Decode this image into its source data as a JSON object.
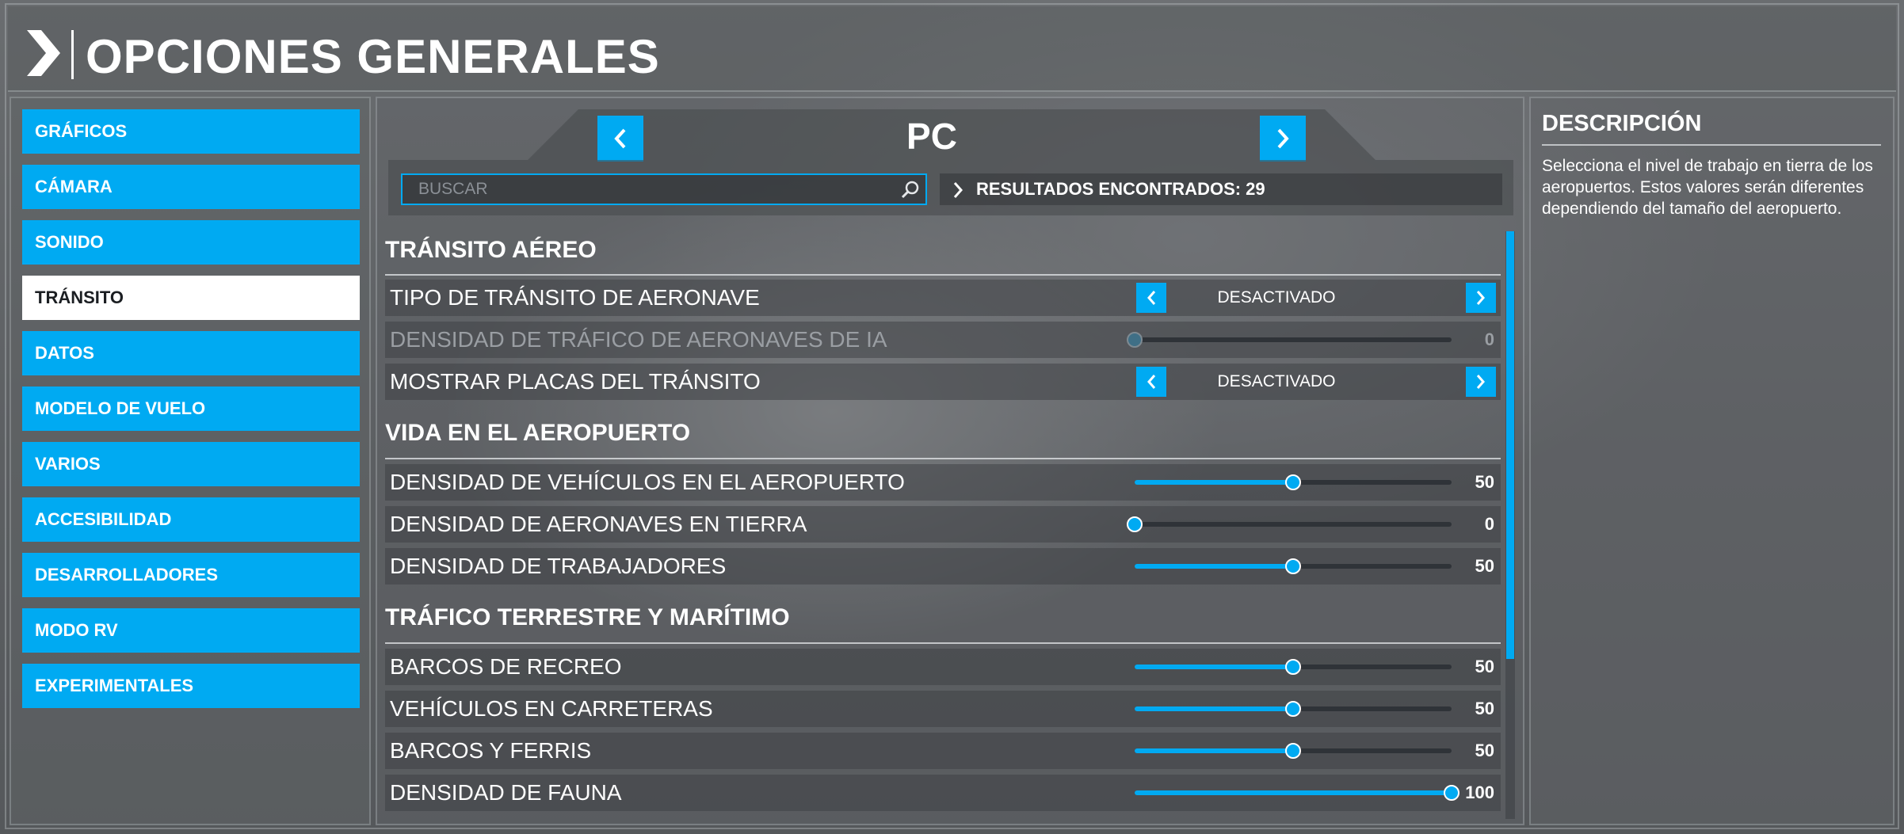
{
  "header": {
    "title": "OPCIONES GENERALES"
  },
  "sidebar": {
    "items": [
      {
        "label": "GRÁFICOS"
      },
      {
        "label": "CÁMARA"
      },
      {
        "label": "SONIDO"
      },
      {
        "label": "TRÁNSITO",
        "active": true
      },
      {
        "label": "DATOS"
      },
      {
        "label": "MODELO DE VUELO"
      },
      {
        "label": "VARIOS"
      },
      {
        "label": "ACCESIBILIDAD"
      },
      {
        "label": "DESARROLLADORES"
      },
      {
        "label": "MODO RV"
      },
      {
        "label": "EXPERIMENTALES"
      }
    ]
  },
  "profile": {
    "name": "PC"
  },
  "search": {
    "placeholder": "BUSCAR"
  },
  "results": {
    "label": "RESULTADOS ENCONTRADOS: 29"
  },
  "sections": [
    {
      "title": "TRÁNSITO AÉREO",
      "rows": [
        {
          "label": "TIPO DE TRÁNSITO DE AERONAVE",
          "type": "toggle",
          "value": "DESACTIVADO"
        },
        {
          "label": "DENSIDAD DE TRÁFICO DE AERONAVES DE IA",
          "type": "slider",
          "value": 0,
          "disabled": true
        },
        {
          "label": "MOSTRAR PLACAS DEL TRÁNSITO",
          "type": "toggle",
          "value": "DESACTIVADO"
        }
      ]
    },
    {
      "title": "VIDA EN EL AEROPUERTO",
      "rows": [
        {
          "label": "DENSIDAD DE VEHÍCULOS EN EL AEROPUERTO",
          "type": "slider",
          "value": 50
        },
        {
          "label": "DENSIDAD DE AERONAVES EN TIERRA",
          "type": "slider",
          "value": 0
        },
        {
          "label": "DENSIDAD DE TRABAJADORES",
          "type": "slider",
          "value": 50
        }
      ]
    },
    {
      "title": "TRÁFICO TERRESTRE Y MARÍTIMO",
      "rows": [
        {
          "label": "BARCOS DE RECREO",
          "type": "slider",
          "value": 50
        },
        {
          "label": "VEHÍCULOS EN CARRETERAS",
          "type": "slider",
          "value": 50
        },
        {
          "label": "BARCOS Y FERRIS",
          "type": "slider",
          "value": 50
        },
        {
          "label": "DENSIDAD DE FAUNA",
          "type": "slider",
          "value": 100
        }
      ]
    }
  ],
  "description": {
    "title": "DESCRIPCIÓN",
    "text": "Selecciona el nivel de trabajo en tierra de los aeropuertos. Estos valores serán diferentes dependiendo del tamaño del aeropuerto."
  },
  "colors": {
    "accent": "#00aaf2",
    "active_item_bg": "#ffffff",
    "active_item_text": "#1b1e22"
  },
  "icons": {
    "header": "chevron-right-icon",
    "prev": "chevron-left-icon",
    "next": "chevron-right-icon",
    "search": "magnifier-icon"
  }
}
